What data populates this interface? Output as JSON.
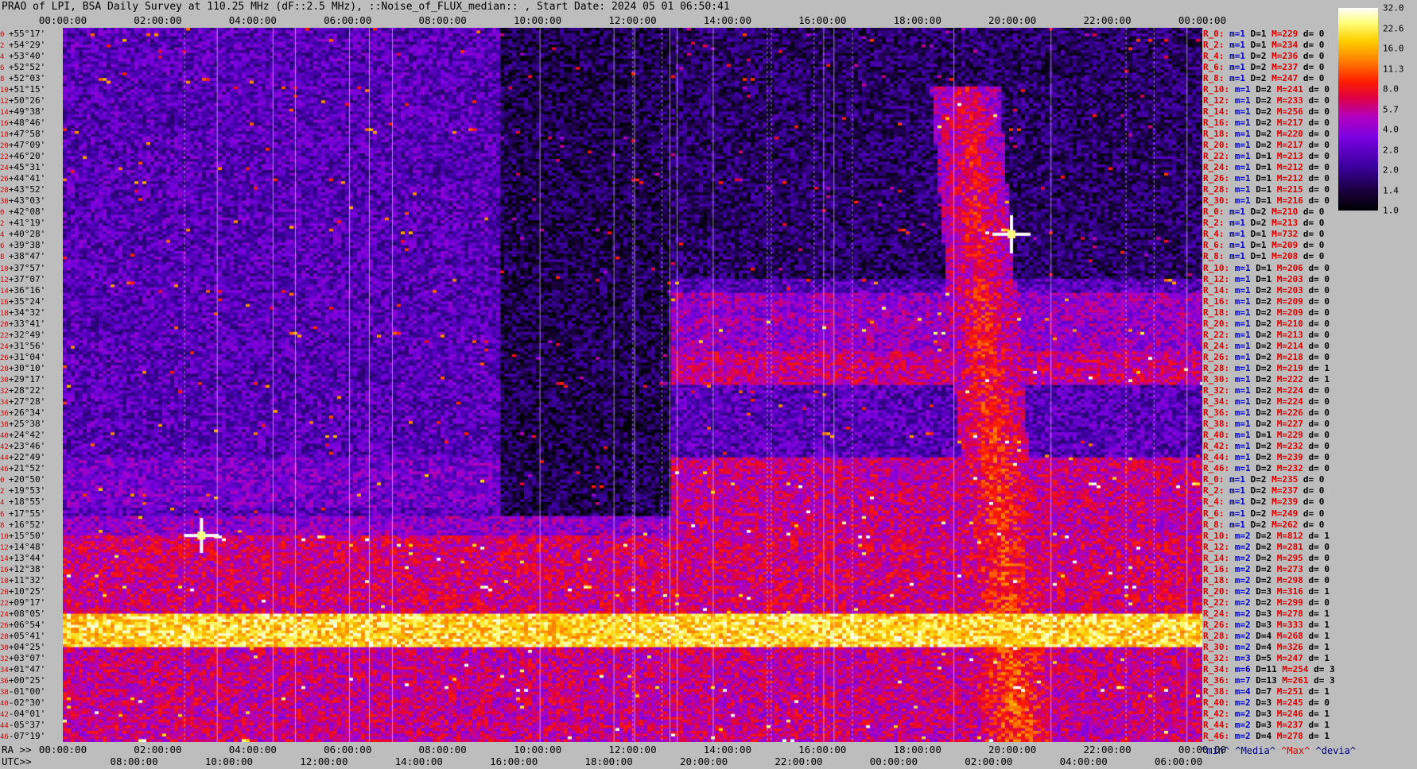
{
  "title": "PRAO of LPI, BSA Daily Survey at 110.25 MHz (dF::2.5 MHz), ::Noise_of_FLUX_median:: , Start Date: 2024 05 01 06:50:41",
  "top_ticks": [
    "00:00:00",
    "02:00:00",
    "04:00:00",
    "06:00:00",
    "08:00:00",
    "10:00:00",
    "12:00:00",
    "14:00:00",
    "16:00:00",
    "18:00:00",
    "20:00:00",
    "22:00:00",
    "00:00:00"
  ],
  "ra_label": "RA >>",
  "ra_ticks": [
    "00:00:00",
    "02:00:00",
    "04:00:00",
    "06:00:00",
    "08:00:00",
    "10:00:00",
    "12:00:00",
    "14:00:00",
    "16:00:00",
    "18:00:00",
    "20:00:00",
    "22:00:00",
    "00:00:00"
  ],
  "utc_label": "UTC>>",
  "utc_ticks": [
    "08:00:00",
    "10:00:00",
    "12:00:00",
    "14:00:00",
    "16:00:00",
    "18:00:00",
    "20:00:00",
    "22:00:00",
    "00:00:00",
    "02:00:00",
    "04:00:00",
    "06:00:00"
  ],
  "declinations": [
    "+55°17'",
    "+54°29'",
    "+53°40'",
    "+52°52'",
    "+52°03'",
    "+51°15'",
    "+50°26'",
    "+49°38'",
    "+48°46'",
    "+47°58'",
    "+47°09'",
    "+46°20'",
    "+45°31'",
    "+44°41'",
    "+43°52'",
    "+43°03'",
    "+42°08'",
    "+41°19'",
    "+40°28'",
    "+39°38'",
    "+38°47'",
    "+37°57'",
    "+37°07'",
    "+36°16'",
    "+35°24'",
    "+34°32'",
    "+33°41'",
    "+32°49'",
    "+31°56'",
    "+31°04'",
    "+30°10'",
    "+29°17'",
    "+28°22'",
    "+27°28'",
    "+26°34'",
    "+25°38'",
    "+24°42'",
    "+23°46'",
    "+22°49'",
    "+21°52'",
    "+20°50'",
    "+19°53'",
    "+18°55'",
    "+17°55'",
    "+16°52'",
    "+15°50'",
    "+14°48'",
    "+13°44'",
    "+12°38'",
    "+11°32'",
    "+10°25'",
    "+09°17'",
    "+08°05'",
    "+06°54'",
    "+05°41'",
    "+04°25'",
    "+03°07'",
    "+01°47'",
    "+00°25'",
    "-01°00'",
    "-02°30'",
    "-04°01'",
    "-05°37'",
    "-07°19'"
  ],
  "dec_indices": [
    "0",
    "2",
    "4",
    "6",
    "8",
    "10",
    "12",
    "14",
    "16",
    "18",
    "20",
    "22",
    "24",
    "26",
    "28",
    "30",
    "0",
    "2",
    "4",
    "6",
    "8",
    "10",
    "12",
    "14",
    "16",
    "18",
    "20",
    "22",
    "24",
    "26",
    "28",
    "30",
    "32",
    "34",
    "36",
    "38",
    "40",
    "42",
    "44",
    "46",
    "0",
    "2",
    "4",
    "6",
    "8",
    "10",
    "12",
    "14",
    "16",
    "18",
    "20",
    "22",
    "24",
    "26",
    "28",
    "30",
    "32",
    "34",
    "36",
    "38",
    "40",
    "42",
    "44",
    "46"
  ],
  "rows": [
    {
      "r": "R_0:",
      "m": "m=1",
      "d": "D=1",
      "mx": "M=229",
      "dd": "d= 0"
    },
    {
      "r": "R_2:",
      "m": "m=1",
      "d": "D=1",
      "mx": "M=234",
      "dd": "d= 0"
    },
    {
      "r": "R_4:",
      "m": "m=1",
      "d": "D=2",
      "mx": "M=236",
      "dd": "d= 0"
    },
    {
      "r": "R_6:",
      "m": "m=1",
      "d": "D=2",
      "mx": "M=237",
      "dd": "d= 0"
    },
    {
      "r": "R_8:",
      "m": "m=1",
      "d": "D=2",
      "mx": "M=247",
      "dd": "d= 0"
    },
    {
      "r": "R_10:",
      "m": "m=1",
      "d": "D=2",
      "mx": "M=241",
      "dd": "d= 0"
    },
    {
      "r": "R_12:",
      "m": "m=1",
      "d": "D=2",
      "mx": "M=233",
      "dd": "d= 0"
    },
    {
      "r": "R_14:",
      "m": "m=1",
      "d": "D=2",
      "mx": "M=256",
      "dd": "d= 0"
    },
    {
      "r": "R_16:",
      "m": "m=1",
      "d": "D=2",
      "mx": "M=217",
      "dd": "d= 0"
    },
    {
      "r": "R_18:",
      "m": "m=1",
      "d": "D=2",
      "mx": "M=220",
      "dd": "d= 0"
    },
    {
      "r": "R_20:",
      "m": "m=1",
      "d": "D=2",
      "mx": "M=217",
      "dd": "d= 0"
    },
    {
      "r": "R_22:",
      "m": "m=1",
      "d": "D=1",
      "mx": "M=213",
      "dd": "d= 0"
    },
    {
      "r": "R_24:",
      "m": "m=1",
      "d": "D=1",
      "mx": "M=212",
      "dd": "d= 0"
    },
    {
      "r": "R_26:",
      "m": "m=1",
      "d": "D=1",
      "mx": "M=212",
      "dd": "d= 0"
    },
    {
      "r": "R_28:",
      "m": "m=1",
      "d": "D=1",
      "mx": "M=215",
      "dd": "d= 0"
    },
    {
      "r": "R_30:",
      "m": "m=1",
      "d": "D=1",
      "mx": "M=216",
      "dd": "d= 0"
    },
    {
      "r": "R_0:",
      "m": "m=1",
      "d": "D=2",
      "mx": "M=210",
      "dd": "d= 0"
    },
    {
      "r": "R_2:",
      "m": "m=1",
      "d": "D=2",
      "mx": "M=213",
      "dd": "d= 0"
    },
    {
      "r": "R_4:",
      "m": "m=1",
      "d": "D=1",
      "mx": "M=732",
      "dd": "d= 0"
    },
    {
      "r": "R_6:",
      "m": "m=1",
      "d": "D=1",
      "mx": "M=209",
      "dd": "d= 0"
    },
    {
      "r": "R_8:",
      "m": "m=1",
      "d": "D=1",
      "mx": "M=208",
      "dd": "d= 0"
    },
    {
      "r": "R_10:",
      "m": "m=1",
      "d": "D=1",
      "mx": "M=206",
      "dd": "d= 0"
    },
    {
      "r": "R_12:",
      "m": "m=1",
      "d": "D=1",
      "mx": "M=203",
      "dd": "d= 0"
    },
    {
      "r": "R_14:",
      "m": "m=1",
      "d": "D=2",
      "mx": "M=203",
      "dd": "d= 0"
    },
    {
      "r": "R_16:",
      "m": "m=1",
      "d": "D=2",
      "mx": "M=209",
      "dd": "d= 0"
    },
    {
      "r": "R_18:",
      "m": "m=1",
      "d": "D=2",
      "mx": "M=209",
      "dd": "d= 0"
    },
    {
      "r": "R_20:",
      "m": "m=1",
      "d": "D=2",
      "mx": "M=210",
      "dd": "d= 0"
    },
    {
      "r": "R_22:",
      "m": "m=1",
      "d": "D=2",
      "mx": "M=213",
      "dd": "d= 0"
    },
    {
      "r": "R_24:",
      "m": "m=1",
      "d": "D=2",
      "mx": "M=214",
      "dd": "d= 0"
    },
    {
      "r": "R_26:",
      "m": "m=1",
      "d": "D=2",
      "mx": "M=218",
      "dd": "d= 0"
    },
    {
      "r": "R_28:",
      "m": "m=1",
      "d": "D=2",
      "mx": "M=219",
      "dd": "d= 1"
    },
    {
      "r": "R_30:",
      "m": "m=1",
      "d": "D=2",
      "mx": "M=222",
      "dd": "d= 1"
    },
    {
      "r": "R_32:",
      "m": "m=1",
      "d": "D=2",
      "mx": "M=224",
      "dd": "d= 0"
    },
    {
      "r": "R_34:",
      "m": "m=1",
      "d": "D=2",
      "mx": "M=224",
      "dd": "d= 0"
    },
    {
      "r": "R_36:",
      "m": "m=1",
      "d": "D=2",
      "mx": "M=226",
      "dd": "d= 0"
    },
    {
      "r": "R_38:",
      "m": "m=1",
      "d": "D=2",
      "mx": "M=227",
      "dd": "d= 0"
    },
    {
      "r": "R_40:",
      "m": "m=1",
      "d": "D=1",
      "mx": "M=229",
      "dd": "d= 0"
    },
    {
      "r": "R_42:",
      "m": "m=1",
      "d": "D=2",
      "mx": "M=232",
      "dd": "d= 0"
    },
    {
      "r": "R_44:",
      "m": "m=1",
      "d": "D=2",
      "mx": "M=239",
      "dd": "d= 0"
    },
    {
      "r": "R_46:",
      "m": "m=1",
      "d": "D=2",
      "mx": "M=232",
      "dd": "d= 0"
    },
    {
      "r": "R_0:",
      "m": "m=1",
      "d": "D=2",
      "mx": "M=235",
      "dd": "d= 0"
    },
    {
      "r": "R_2:",
      "m": "m=1",
      "d": "D=2",
      "mx": "M=237",
      "dd": "d= 0"
    },
    {
      "r": "R_4:",
      "m": "m=1",
      "d": "D=2",
      "mx": "M=239",
      "dd": "d= 0"
    },
    {
      "r": "R_6:",
      "m": "m=1",
      "d": "D=2",
      "mx": "M=249",
      "dd": "d= 0"
    },
    {
      "r": "R_8:",
      "m": "m=1",
      "d": "D=2",
      "mx": "M=262",
      "dd": "d= 0"
    },
    {
      "r": "R_10:",
      "m": "m=2",
      "d": "D=2",
      "mx": "M=812",
      "dd": "d= 1"
    },
    {
      "r": "R_12:",
      "m": "m=2",
      "d": "D=2",
      "mx": "M=281",
      "dd": "d= 0"
    },
    {
      "r": "R_14:",
      "m": "m=2",
      "d": "D=2",
      "mx": "M=295",
      "dd": "d= 0"
    },
    {
      "r": "R_16:",
      "m": "m=2",
      "d": "D=2",
      "mx": "M=273",
      "dd": "d= 0"
    },
    {
      "r": "R_18:",
      "m": "m=2",
      "d": "D=2",
      "mx": "M=298",
      "dd": "d= 0"
    },
    {
      "r": "R_20:",
      "m": "m=2",
      "d": "D=3",
      "mx": "M=316",
      "dd": "d= 1"
    },
    {
      "r": "R_22:",
      "m": "m=2",
      "d": "D=2",
      "mx": "M=299",
      "dd": "d= 0"
    },
    {
      "r": "R_24:",
      "m": "m=2",
      "d": "D=3",
      "mx": "M=278",
      "dd": "d= 1"
    },
    {
      "r": "R_26:",
      "m": "m=2",
      "d": "D=3",
      "mx": "M=333",
      "dd": "d= 1"
    },
    {
      "r": "R_28:",
      "m": "m=2",
      "d": "D=4",
      "mx": "M=268",
      "dd": "d= 1"
    },
    {
      "r": "R_30:",
      "m": "m=2",
      "d": "D=4",
      "mx": "M=326",
      "dd": "d= 1"
    },
    {
      "r": "R_32:",
      "m": "m=3",
      "d": "D=5",
      "mx": "M=247",
      "dd": "d= 1"
    },
    {
      "r": "R_34:",
      "m": "m=6",
      "d": "D=11",
      "mx": "M=254",
      "dd": "d= 3"
    },
    {
      "r": "R_36:",
      "m": "m=7",
      "d": "D=13",
      "mx": "M=261",
      "dd": "d= 3"
    },
    {
      "r": "R_38:",
      "m": "m=4",
      "d": "D=7",
      "mx": "M=251",
      "dd": "d= 1"
    },
    {
      "r": "R_40:",
      "m": "m=2",
      "d": "D=3",
      "mx": "M=245",
      "dd": "d= 0"
    },
    {
      "r": "R_42:",
      "m": "m=2",
      "d": "D=3",
      "mx": "M=246",
      "dd": "d= 1"
    },
    {
      "r": "R_44:",
      "m": "m=2",
      "d": "D=3",
      "mx": "M=237",
      "dd": "d= 1"
    },
    {
      "r": "R_46:",
      "m": "m=2",
      "d": "D=4",
      "mx": "M=278",
      "dd": "d= 1"
    }
  ],
  "legend": {
    "min": "^min^",
    "median": "^Media^",
    "max": "^Max^",
    "dev": "^devia^"
  },
  "colorbar": {
    "ticks": [
      "32.0",
      "22.6",
      "16.0",
      "11.3",
      "8.0",
      "5.7",
      "4.0",
      "2.8",
      "2.0",
      "1.4",
      "1.0"
    ],
    "scale": "log"
  },
  "colors": {
    "background": "#bdbdbd",
    "label_red": "#e00000",
    "label_blue": "#0000cc"
  },
  "chart_data": {
    "type": "heatmap",
    "title": "PRAO of LPI, BSA Daily Survey at 110.25 MHz (dF::2.5 MHz), ::Noise_of_FLUX_median:: , Start Date: 2024 05 01 06:50:41",
    "x_axis_ra": {
      "label": "RA >>",
      "range": [
        "00:00:00",
        "00:00:00 (+24h)"
      ]
    },
    "x_axis_utc": {
      "label": "UTC>>"
    },
    "y_axis": {
      "range": [
        "+55°17'",
        "-07°19'"
      ],
      "rows": 64
    },
    "color_scale": {
      "min": 1.0,
      "max": 32.0,
      "type": "log",
      "colormap": "black-purple-red-yellow-white"
    },
    "features": [
      {
        "name": "bright-band",
        "dec_range": [
          "+01°47'",
          "+00°25'"
        ],
        "level": "high"
      },
      {
        "name": "bright-source",
        "ra": "02:55",
        "dec": "+15°50'",
        "level": "max"
      },
      {
        "name": "bright-source",
        "ra": "19:59",
        "dec": "+40°28'",
        "level": "max"
      },
      {
        "name": "diagonal-plume",
        "ra_range": [
          "19:00",
          "21:00"
        ],
        "dec_range": [
          "+47°",
          "-07°"
        ],
        "level": "medium"
      }
    ]
  }
}
